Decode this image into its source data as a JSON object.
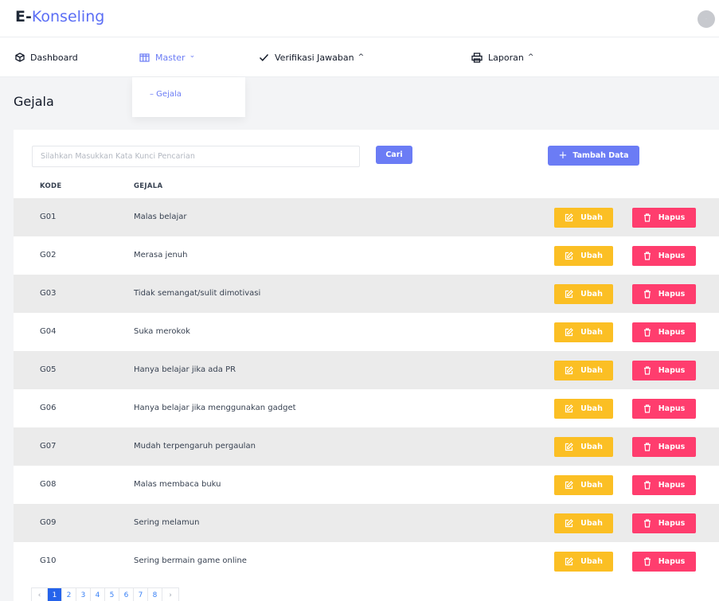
{
  "app": {
    "brand_bold": "E-",
    "brand_rest": "Konseling",
    "avatar_text": "·"
  },
  "nav": {
    "dashboard": "Dashboard",
    "master": "Master",
    "master_chevron": "⌄",
    "verifikasi": "Verifikasi Jawaban",
    "verifikasi_chevron": "^",
    "laporan": "Laporan",
    "laporan_chevron": "^"
  },
  "dropdown": {
    "item": "–  Gejala"
  },
  "page": {
    "title": "Gejala"
  },
  "toolbar": {
    "search_placeholder": "Silahkan Masukkan Kata Kunci Pencarian",
    "search_button": "Cari",
    "add_plus": "+",
    "add_button": "Tambah Data"
  },
  "table": {
    "headers": {
      "code": "KODE",
      "name": "GEJALA"
    },
    "edit_label": "Ubah",
    "delete_label": "Hapus",
    "rows": [
      {
        "code": "G01",
        "name": "Malas belajar"
      },
      {
        "code": "G02",
        "name": "Merasa jenuh"
      },
      {
        "code": "G03",
        "name": "Tidak semangat/sulit dimotivasi"
      },
      {
        "code": "G04",
        "name": "Suka merokok"
      },
      {
        "code": "G05",
        "name": "Hanya belajar jika ada PR"
      },
      {
        "code": "G06",
        "name": "Hanya belajar jika menggunakan gadget"
      },
      {
        "code": "G07",
        "name": "Mudah terpengaruh pergaulan"
      },
      {
        "code": "G08",
        "name": "Malas membaca buku"
      },
      {
        "code": "G09",
        "name": "Sering melamun"
      },
      {
        "code": "G10",
        "name": "Sering bermain game online"
      }
    ]
  },
  "pagination": {
    "prev": "‹",
    "pages": [
      "1",
      "2",
      "3",
      "4",
      "5",
      "6",
      "7",
      "8"
    ],
    "next": "›",
    "current": "1"
  },
  "colors": {
    "accent": "#6b7cf5",
    "edit": "#fbbf24",
    "delete": "#ff3d6e",
    "row_shade": "#ebebeb",
    "page_active": "#2563eb"
  },
  "icons": {
    "dashboard": "box-icon",
    "master": "columns-icon",
    "verifikasi": "check-icon",
    "laporan": "printer-icon",
    "edit": "edit-icon",
    "delete": "trash-icon"
  }
}
